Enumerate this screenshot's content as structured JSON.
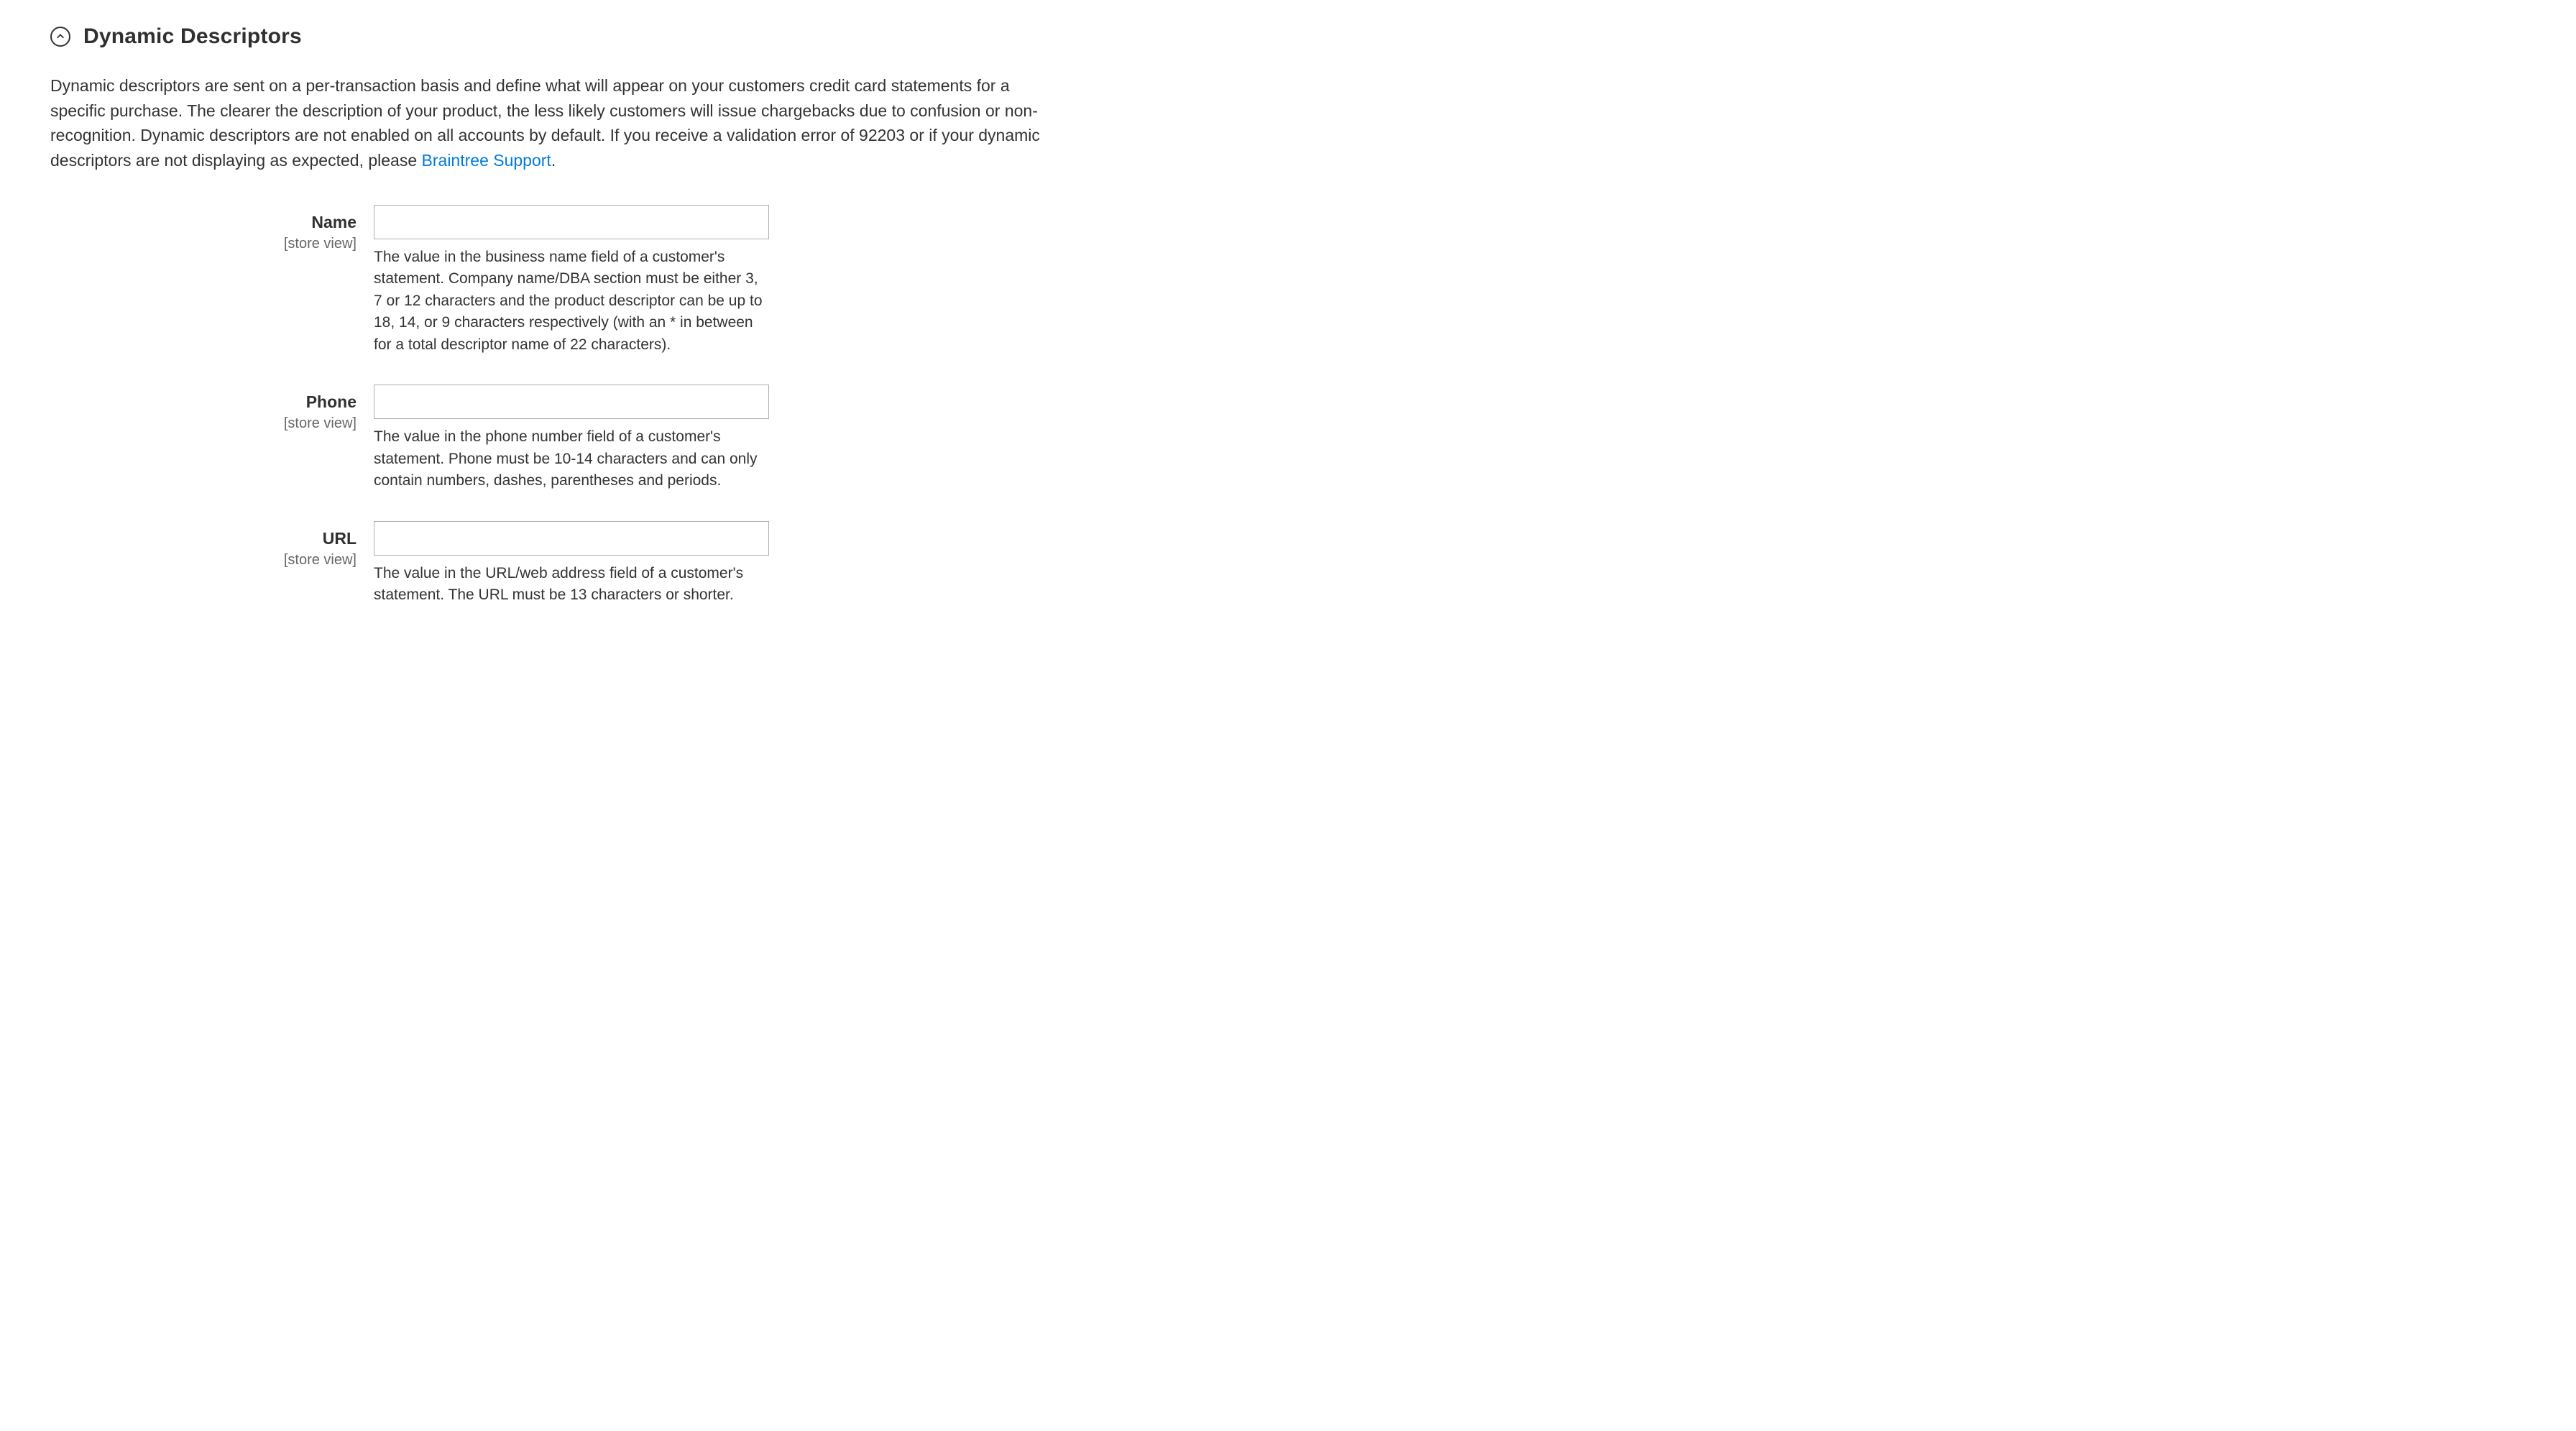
{
  "section": {
    "title": "Dynamic Descriptors",
    "intro_text": "Dynamic descriptors are sent on a per-transaction basis and define what will appear on your customers credit card statements for a specific purchase. The clearer the description of your product, the less likely customers will issue chargebacks due to confusion or non-recognition. Dynamic descriptors are not enabled on all accounts by default. If you receive a validation error of 92203 or if your dynamic descriptors are not displaying as expected, please ",
    "intro_link_text": "Braintree Support",
    "intro_suffix": "."
  },
  "fields": {
    "name": {
      "label": "Name",
      "scope": "[store view]",
      "value": "",
      "help": "The value in the business name field of a customer's statement. Company name/DBA section must be either 3, 7 or 12 characters and the product descriptor can be up to 18, 14, or 9 characters respectively (with an * in between for a total descriptor name of 22 characters)."
    },
    "phone": {
      "label": "Phone",
      "scope": "[store view]",
      "value": "",
      "help": "The value in the phone number field of a customer's statement. Phone must be 10-14 characters and can only contain numbers, dashes, parentheses and periods."
    },
    "url": {
      "label": "URL",
      "scope": "[store view]",
      "value": "",
      "help": "The value in the URL/web address field of a customer's statement. The URL must be 13 characters or shorter."
    }
  }
}
